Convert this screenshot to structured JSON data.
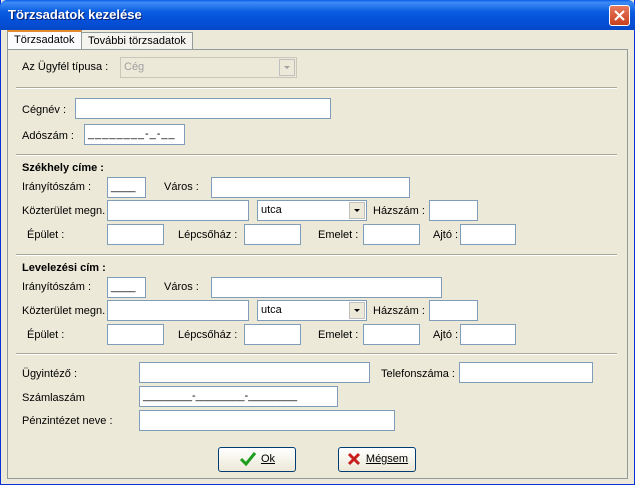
{
  "window": {
    "title": "Törzsadatok kezelése"
  },
  "tabs": [
    {
      "label": "Törzsadatok"
    },
    {
      "label": "További törzsadatok"
    }
  ],
  "client_type": {
    "label": "Az Ügyfél típusa :",
    "value": "Cég"
  },
  "company": {
    "name_label": "Cégnév :",
    "name_value": "",
    "tax_label": "Adószám :",
    "tax_value": "________-_-__"
  },
  "seat": {
    "heading": "Székhely címe :",
    "zip_label": "Irányítószám :",
    "zip_value": "____",
    "city_label": "Város :",
    "city_value": "",
    "street_label": "Közterület megn. :",
    "street_value": "",
    "street_type": "utca",
    "house_label": "Házszám :",
    "house_value": "",
    "building_label": "Épület :",
    "stair_label": "Lépcsőház :",
    "floor_label": "Emelet :",
    "door_label": "Ajtó :"
  },
  "mail": {
    "heading": "Levelezési cím :",
    "zip_label": "Irányítószám :",
    "zip_value": "____",
    "city_label": "Város :",
    "city_value": "",
    "street_label": "Közterület megn. :",
    "street_value": "",
    "street_type": "utca",
    "house_label": "Házszám :",
    "house_value": "",
    "building_label": "Épület :",
    "stair_label": "Lépcsőház :",
    "floor_label": "Emelet :",
    "door_label": "Ajtó :"
  },
  "admin": {
    "agent_label": "Ügyintéző :",
    "agent_value": "",
    "phone_label": "Telefonszáma :",
    "phone_value": "",
    "account_label": "Számlaszám",
    "account_value": "________-________-________",
    "bank_label": "Pénzintézet neve :",
    "bank_value": ""
  },
  "buttons": {
    "ok": "Ok",
    "cancel": "Mégsem"
  },
  "colors": {
    "titlebar": "#0550d8",
    "face": "#ece9d8",
    "ok_icon": "#1e9e1e",
    "cancel_icon": "#c81e1e"
  }
}
